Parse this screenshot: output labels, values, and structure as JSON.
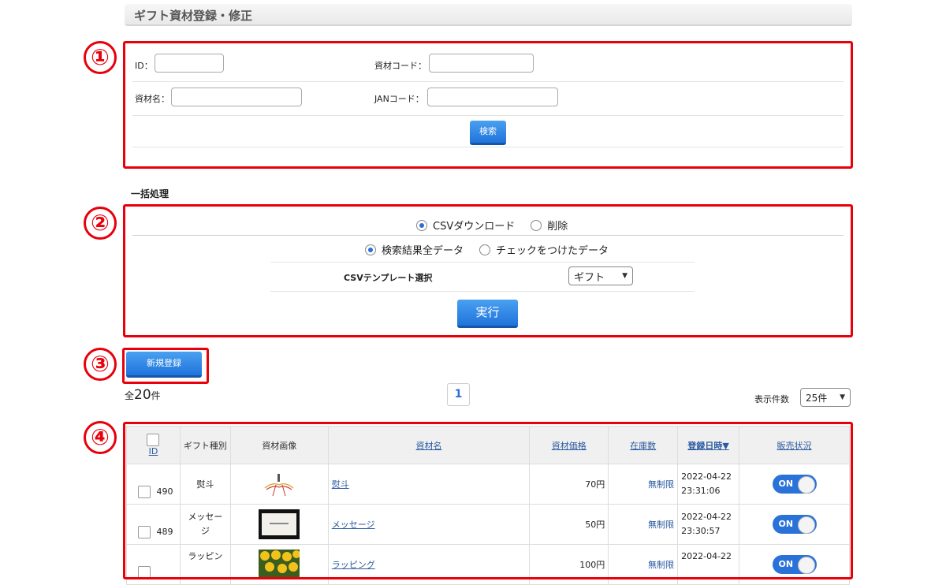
{
  "page_title": "ギフト資材登録・修正",
  "markers": [
    "①",
    "②",
    "③",
    "④"
  ],
  "search": {
    "id_label": "ID：",
    "code_label": "資材コード：",
    "name_label": "資材名：",
    "jan_label": "JANコード：",
    "button": "検索"
  },
  "batch": {
    "heading": "一括処理",
    "action_options": [
      "CSVダウンロード",
      "削除"
    ],
    "target_options": [
      "検索結果全データ",
      "チェックをつけたデータ"
    ],
    "template_label": "CSVテンプレート選択",
    "template_value": "ギフト",
    "execute": "実行"
  },
  "new_button": "新規登録",
  "summary": {
    "prefix": "全",
    "count": "20",
    "suffix": "件"
  },
  "pagination": {
    "current": "1"
  },
  "per_page": {
    "label": "表示件数",
    "value": "25件"
  },
  "table": {
    "headers": {
      "id": "ID",
      "gift_type": "ギフト種別",
      "image": "資材画像",
      "name": "資材名",
      "price": "資材価格",
      "stock": "在庫数",
      "date": "登録日時▼",
      "status": "販売状況"
    },
    "rows": [
      {
        "id": "490",
        "gift_type": "熨斗",
        "name": "熨斗",
        "price": "70円",
        "stock": "無制限",
        "date": "2022-04-22",
        "time": "23:31:06",
        "status": "ON"
      },
      {
        "id": "489",
        "gift_type": "メッセージ",
        "name": "メッセージ",
        "price": "50円",
        "stock": "無制限",
        "date": "2022-04-22",
        "time": "23:30:57",
        "status": "ON"
      },
      {
        "id": "",
        "gift_type": "ラッピン",
        "name": "ラッピング",
        "price": "100円",
        "stock": "無制限",
        "date": "2022-04-22",
        "time": "",
        "status": "ON"
      }
    ]
  },
  "colors": {
    "marker_red": "#e8000b",
    "button_blue": "#1f74dc",
    "link_blue": "#2b5aa0"
  }
}
